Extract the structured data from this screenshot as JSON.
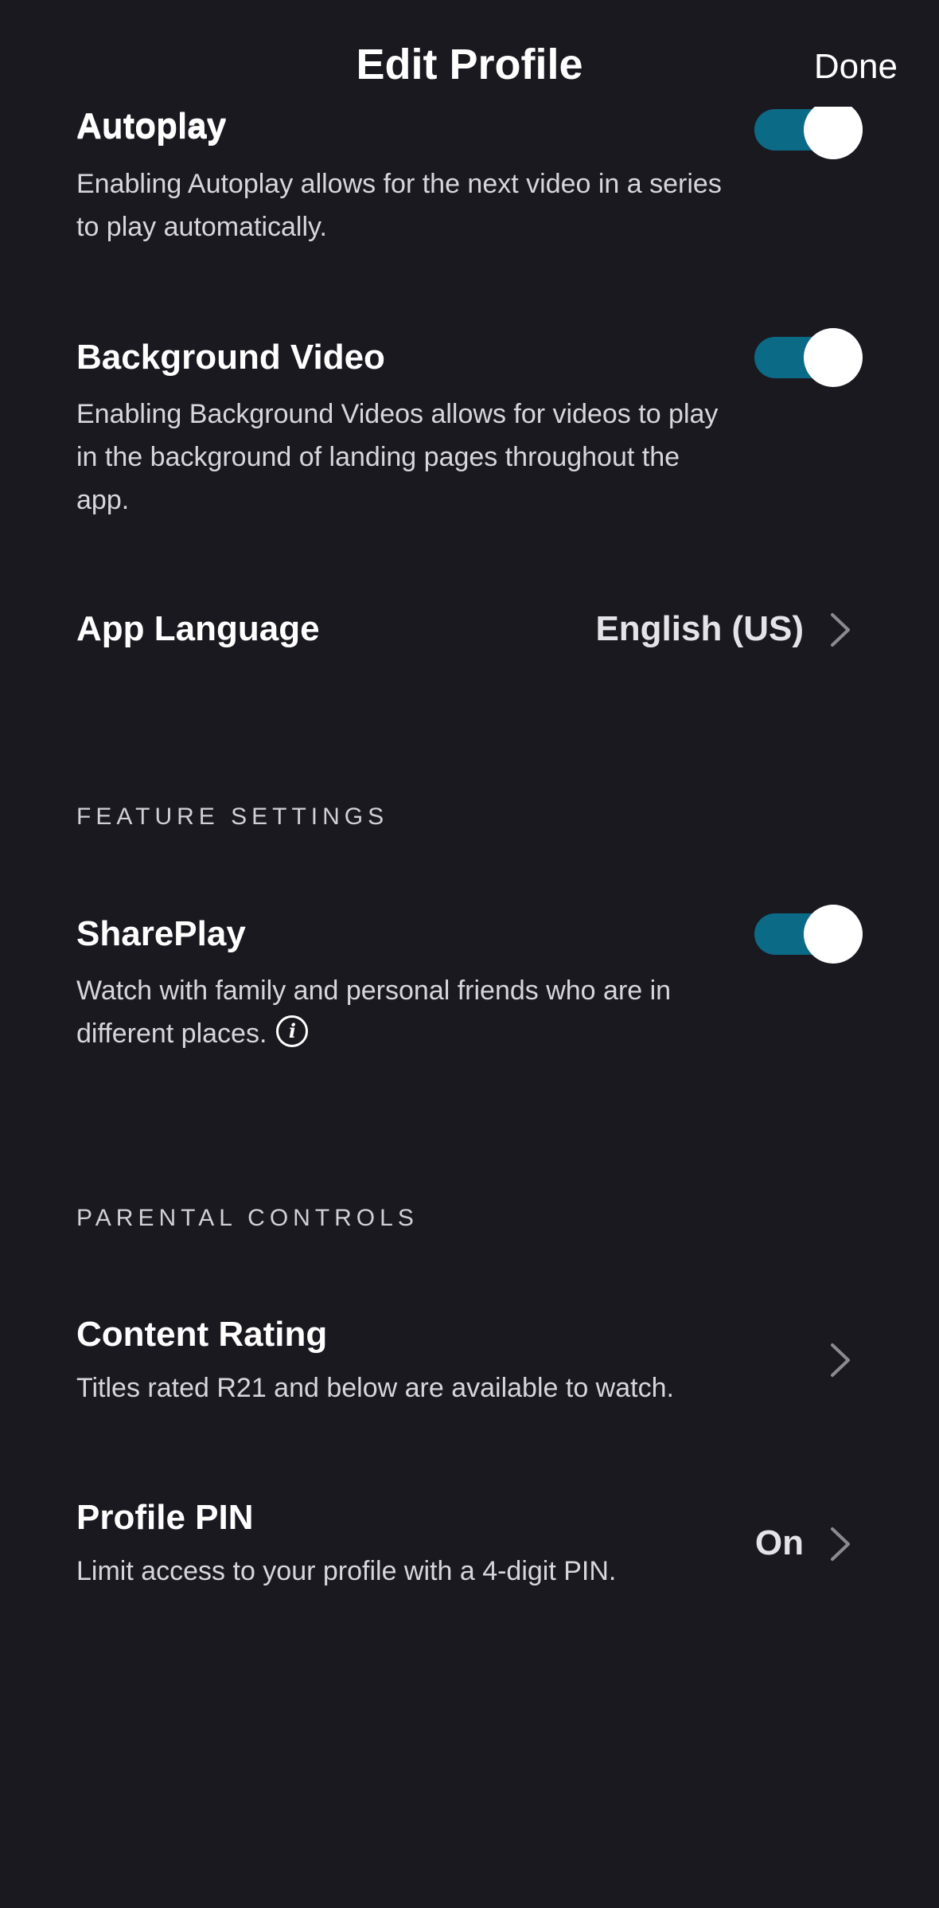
{
  "header": {
    "title": "Edit Profile",
    "done_label": "Done"
  },
  "autoplay": {
    "title": "Autoplay",
    "description": "Enabling Autoplay allows for the next video in a series to play automatically.",
    "enabled": true
  },
  "background_video": {
    "title": "Background Video",
    "description": "Enabling Background Videos allows for videos to play in the background of landing pages throughout the app.",
    "enabled": true
  },
  "app_language": {
    "title": "App Language",
    "value": "English (US)"
  },
  "feature_settings": {
    "section_label": "FEATURE SETTINGS",
    "shareplay": {
      "title": "SharePlay",
      "description": "Watch with family and personal friends who are in different places.",
      "enabled": true
    }
  },
  "parental_controls": {
    "section_label": "PARENTAL CONTROLS",
    "content_rating": {
      "title": "Content Rating",
      "description": "Titles rated R21 and below are available to watch."
    },
    "profile_pin": {
      "title": "Profile PIN",
      "description": "Limit access to your profile with a 4-digit PIN.",
      "value": "On"
    }
  },
  "colors": {
    "background": "#1a1920",
    "toggle_on": "#0b6a86",
    "text": "#ffffff"
  }
}
